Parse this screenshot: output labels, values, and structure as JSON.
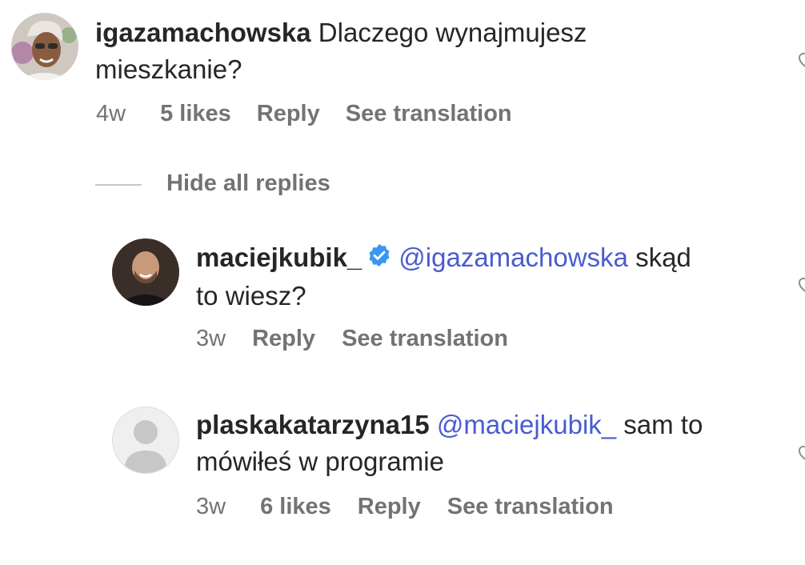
{
  "comments": [
    {
      "username": "igazamachowska",
      "text_line1": "Dlaczego wynajmujesz",
      "text_line2": "mieszkanie?",
      "time": "4w",
      "likes": "5 likes",
      "reply_label": "Reply",
      "translate_label": "See translation"
    }
  ],
  "replies_toggle": {
    "label": "Hide all replies"
  },
  "replies": [
    {
      "username": "maciejkubik_",
      "verified": true,
      "mention": "@igazamachowska",
      "text_line1_tail": "skąd",
      "text_line2": "to wiesz?",
      "time": "3w",
      "reply_label": "Reply",
      "translate_label": "See translation"
    },
    {
      "username": "plaskakatarzyna15",
      "mention": "@maciejkubik_",
      "text_line1_tail": "sam to",
      "text_line2": "mówiłeś w programie",
      "time": "3w",
      "likes": "6 likes",
      "reply_label": "Reply",
      "translate_label": "See translation"
    }
  ],
  "colors": {
    "text": "#262626",
    "secondary": "#737373",
    "mention": "#4a5bd0",
    "verified": "#3897f0"
  }
}
